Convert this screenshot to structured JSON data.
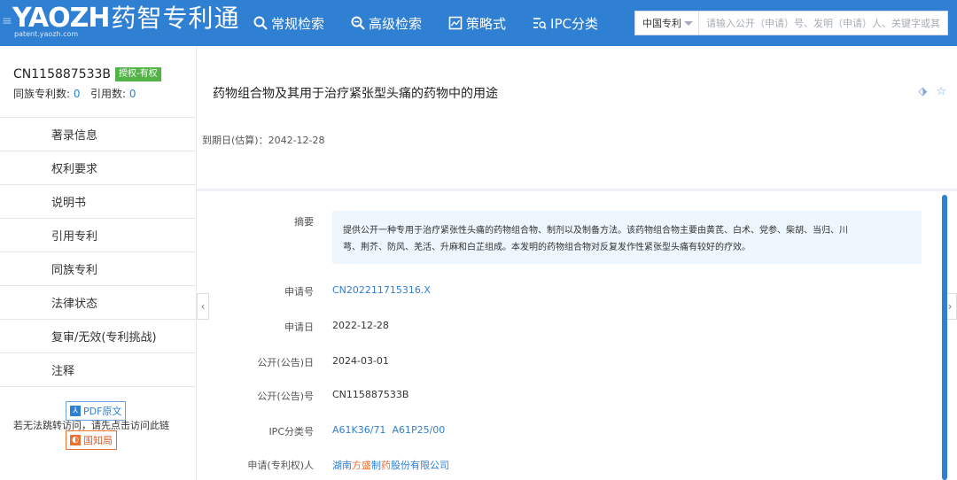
{
  "header": {
    "logo_text": "YAOZH",
    "logo_cn": "药智专利通",
    "logo_sub": "patent.yaozh.com",
    "nav": [
      "常规检索",
      "高级检索",
      "策略式",
      "IPC分类"
    ],
    "search_scope": "中国专利",
    "search_placeholder": "请输入公开（申请）号、发明（申请）人、关键字或其"
  },
  "sidebar": {
    "pub_number": "CN115887533B",
    "status_badge": "授权-有权",
    "family_label": "同族专利数:",
    "family_count": "0",
    "cite_label": "引用数:",
    "cite_count": "0",
    "items": [
      "著录信息",
      "权利要求",
      "说明书",
      "引用专利",
      "同族专利",
      "法律状态",
      "复审/无效(专利挑战)",
      "注释"
    ],
    "pdf_button": "PDF原文",
    "gov_button": "国知局",
    "note": "若无法跳转访问，请先点击访问此链"
  },
  "patent": {
    "title": "药物组合物及其用于治疗紧张型头痛的药物中的用途",
    "expiry": "到期日(估算)：2042-12-28"
  },
  "details": {
    "abstract_label": "摘要",
    "abstract_line1": "提供公开一种专用于治疗紧张性头痛的药物组合物、制剂以及制备方法。该药物组合物主要由黄芪、白术、党参、柴胡、当归、川",
    "abstract_line2": "芎、荆芥、防风、羌活、升麻和白芷组成。本发明的药物组合物对反复发作性紧张型头痛有较好的疗效。",
    "app_no_label": "申请号",
    "app_no": "CN202211715316.X",
    "app_date_label": "申请日",
    "app_date": "2022-12-28",
    "pub_date_label": "公开(公告)日",
    "pub_date": "2024-03-01",
    "pub_no_label": "公开(公告)号",
    "pub_no": "CN115887533B",
    "ipc_label": "IPC分类号",
    "ipc1": "A61K36/71",
    "ipc2": "A61P25/00",
    "applicant_label": "申请(专利权)人",
    "applicant_a": "湖南",
    "applicant_b": "方盛",
    "applicant_c": "制",
    "applicant_d": "药",
    "applicant_e": "股份有限公司"
  },
  "colors": {
    "brand_blue": "#2f7fd3",
    "badge_green": "#52b447",
    "accent_orange": "#f07030",
    "abstract_bg": "#eef7fd"
  }
}
